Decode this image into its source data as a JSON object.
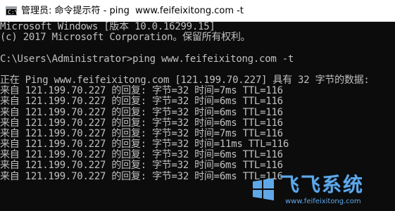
{
  "window": {
    "title": "管理员: 命令提示符 - ping  www.feifeixitong.com -t"
  },
  "console": {
    "lines": [
      "Microsoft Windows [版本 10.0.16299.15]",
      "(c) 2017 Microsoft Corporation。保留所有权利。",
      "",
      "C:\\Users\\Administrator>ping www.feifeixitong.com -t",
      "",
      "正在 Ping www.feifeixitong.com [121.199.70.227] 具有 32 字节的数据:",
      "来自 121.199.70.227 的回复: 字节=32 时间=7ms TTL=116",
      "来自 121.199.70.227 的回复: 字节=32 时间=6ms TTL=116",
      "来自 121.199.70.227 的回复: 字节=32 时间=6ms TTL=116",
      "来自 121.199.70.227 的回复: 字节=32 时间=6ms TTL=116",
      "来自 121.199.70.227 的回复: 字节=32 时间=7ms TTL=116",
      "来自 121.199.70.227 的回复: 字节=32 时间=11ms TTL=116",
      "来自 121.199.70.227 的回复: 字节=32 时间=6ms TTL=116",
      "来自 121.199.70.227 的回复: 字节=32 时间=6ms TTL=116",
      "来自 121.199.70.227 的回复: 字节=32 时间=6ms TTL=116"
    ]
  },
  "watermark": {
    "brand": "飞飞系统",
    "url": "www.feifeixitong.com",
    "icon": "windows-logo-icon",
    "color": "#5fa8e8"
  },
  "colors": {
    "console_bg": "#0c0c0c",
    "console_fg": "#c0c0c0",
    "titlebar_bg": "#ffffff"
  }
}
